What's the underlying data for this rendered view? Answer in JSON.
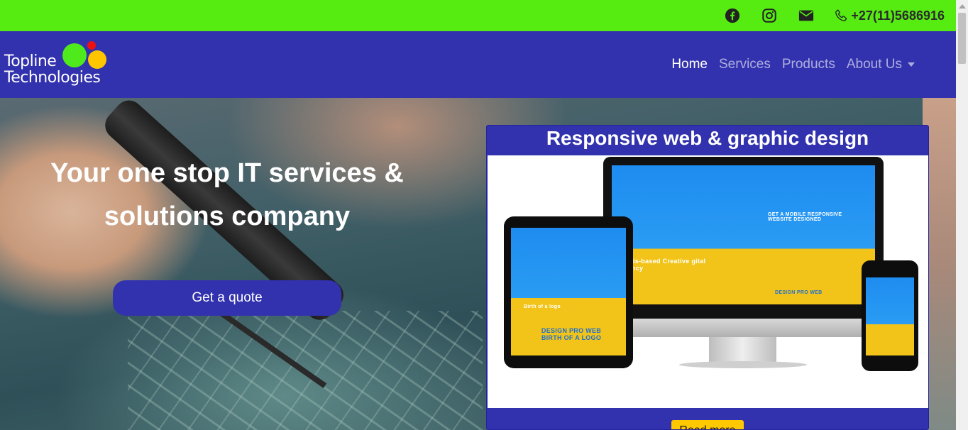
{
  "topbar": {
    "social": [
      {
        "icon": "facebook-icon"
      },
      {
        "icon": "instagram-icon"
      },
      {
        "icon": "mail-icon"
      }
    ],
    "phone": "+27(11)5686916",
    "phone_icon": "phone-icon",
    "background": "#56ec12"
  },
  "brand": {
    "line1": "Topline",
    "line2": "Technologies",
    "circle_colors": [
      "#4fea1c",
      "#f01010",
      "#ffc600"
    ]
  },
  "nav": {
    "items": [
      {
        "label": "Home",
        "active": true
      },
      {
        "label": "Services",
        "active": false
      },
      {
        "label": "Products",
        "active": false
      },
      {
        "label": "About Us",
        "active": false,
        "dropdown": true
      }
    ],
    "background": "#3232ae"
  },
  "hero": {
    "title": "Your one stop IT services & solutions company",
    "cta": "Get a quote"
  },
  "card": {
    "title": "Responsive web & graphic design",
    "button": "Read more",
    "button_color": "#ffc800",
    "mockup_text": {
      "monitor_headline": "GET A MOBILE RESPONSIVE WEBSITE DESIGNED",
      "monitor_sub": "mphis-based Creative gital Agency",
      "monitor_box": "DESIGN PRO WEB",
      "tablet_box": "DESIGN PRO WEB BIRTH OF A LOGO",
      "birth_label": "Birth of a logo"
    }
  }
}
